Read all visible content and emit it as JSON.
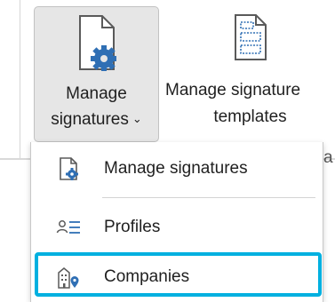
{
  "ribbon": {
    "manage_signatures": {
      "line1": "Manage",
      "line2": "signatures",
      "chevron": "⌄",
      "icon": "document-gear-icon"
    },
    "manage_templates": {
      "line1": "Manage signature",
      "line2": "templates",
      "icon": "template-document-icon"
    },
    "partial_text": "a"
  },
  "dropdown": {
    "items": [
      {
        "label": "Manage signatures",
        "icon": "document-gear-icon"
      },
      {
        "label": "Profiles",
        "icon": "profiles-list-icon"
      },
      {
        "label": "Companies",
        "icon": "building-location-icon"
      }
    ],
    "highlighted_item": "Companies"
  },
  "colors": {
    "button_pressed_bg": "#e6e6e6",
    "accent_blue": "#2f6fb4",
    "highlight_border": "#00b0e0"
  }
}
